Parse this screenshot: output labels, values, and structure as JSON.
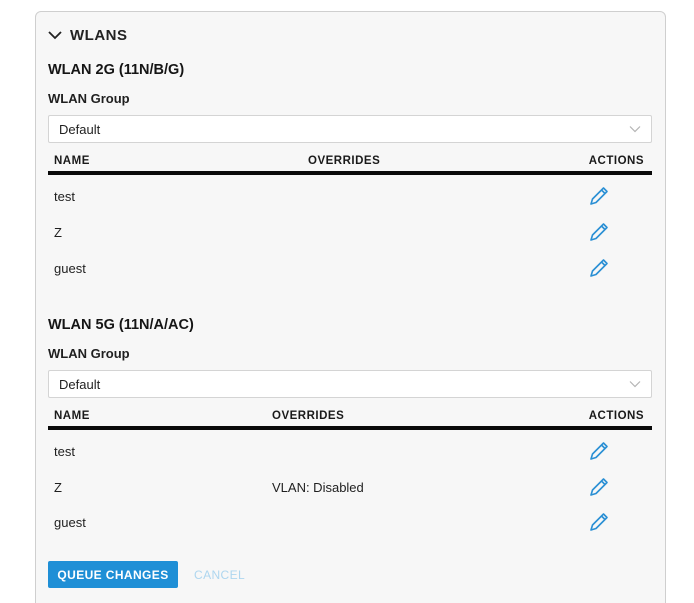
{
  "panel": {
    "title": "WLANS",
    "toggle_icon": "chevron-down-icon"
  },
  "sections": [
    {
      "title": "WLAN 2G (11N/B/G)",
      "group_label": "WLAN Group",
      "group_value": "Default",
      "columns": {
        "name": "NAME",
        "overrides": "OVERRIDES",
        "actions": "ACTIONS"
      },
      "rows": [
        {
          "name": "test",
          "overrides": ""
        },
        {
          "name": "Z",
          "overrides": ""
        },
        {
          "name": "guest",
          "overrides": ""
        }
      ]
    },
    {
      "title": "WLAN 5G (11N/A/AC)",
      "group_label": "WLAN Group",
      "group_value": "Default",
      "columns": {
        "name": "NAME",
        "overrides": "OVERRIDES",
        "actions": "ACTIONS"
      },
      "rows": [
        {
          "name": "test",
          "overrides": ""
        },
        {
          "name": "Z",
          "overrides": "VLAN: Disabled"
        },
        {
          "name": "guest",
          "overrides": ""
        }
      ]
    }
  ],
  "buttons": {
    "queue": "QUEUE CHANGES",
    "cancel": "CANCEL"
  },
  "colors": {
    "accent": "#1f8fd6",
    "edit_icon": "#2a8fd4",
    "table_rule": "#0a0a0a"
  },
  "icons": {
    "edit": "pencil-icon",
    "select_caret": "chevron-down-icon"
  }
}
